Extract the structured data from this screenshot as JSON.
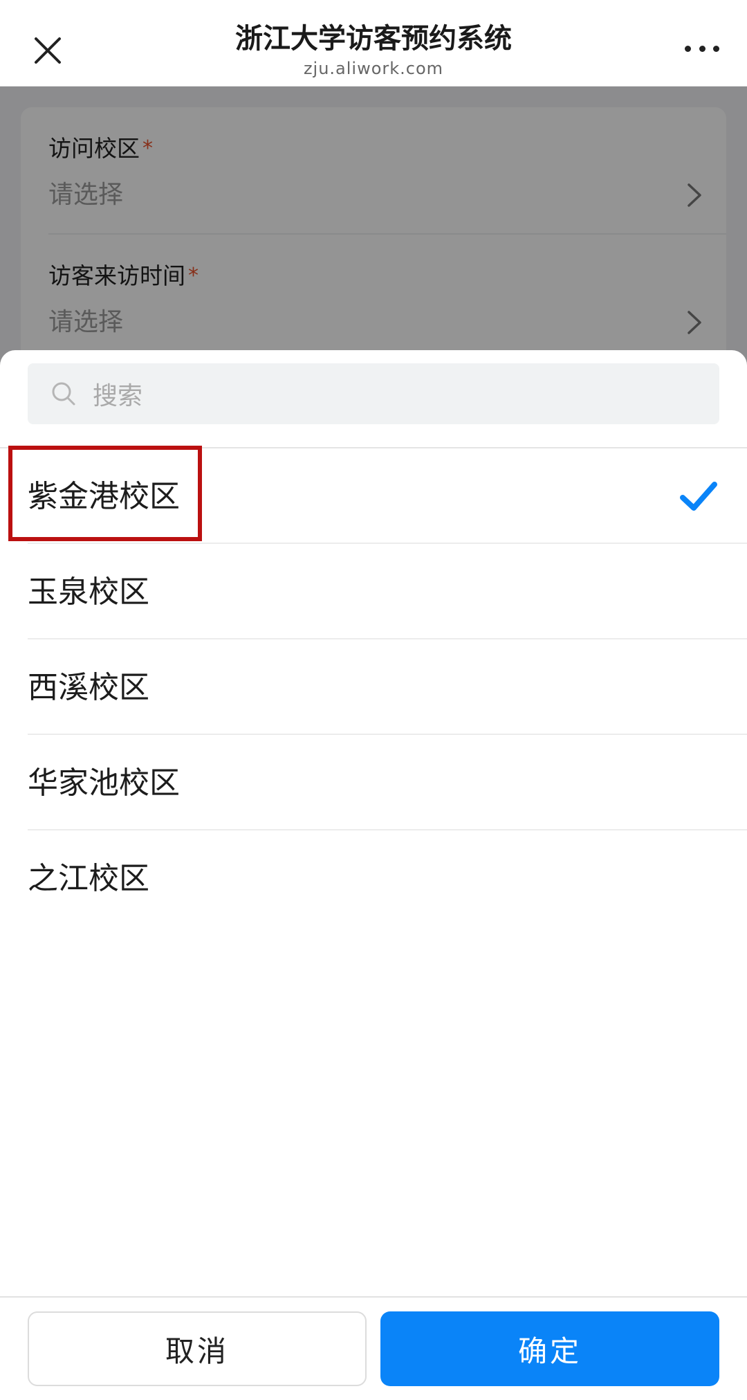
{
  "header": {
    "title": "浙江大学访客预约系统",
    "subtitle": "zju.aliwork.com"
  },
  "form": {
    "fields": [
      {
        "label": "访问校区",
        "required_mark": "*",
        "value": "请选择"
      },
      {
        "label": "访客来访时间",
        "required_mark": "*",
        "value": "请选择"
      }
    ]
  },
  "picker": {
    "search_placeholder": "搜索",
    "selected_index": 0,
    "options": [
      "紫金港校区",
      "玉泉校区",
      "西溪校区",
      "华家池校区",
      "之江校区"
    ]
  },
  "footer": {
    "cancel_label": "取消",
    "confirm_label": "确定"
  },
  "colors": {
    "accent": "#0a84f8",
    "highlight_border": "#bb1010",
    "required": "#e8512b"
  },
  "icons": [
    "close-icon",
    "more-icon",
    "chevron-right-icon",
    "search-icon",
    "check-icon"
  ]
}
